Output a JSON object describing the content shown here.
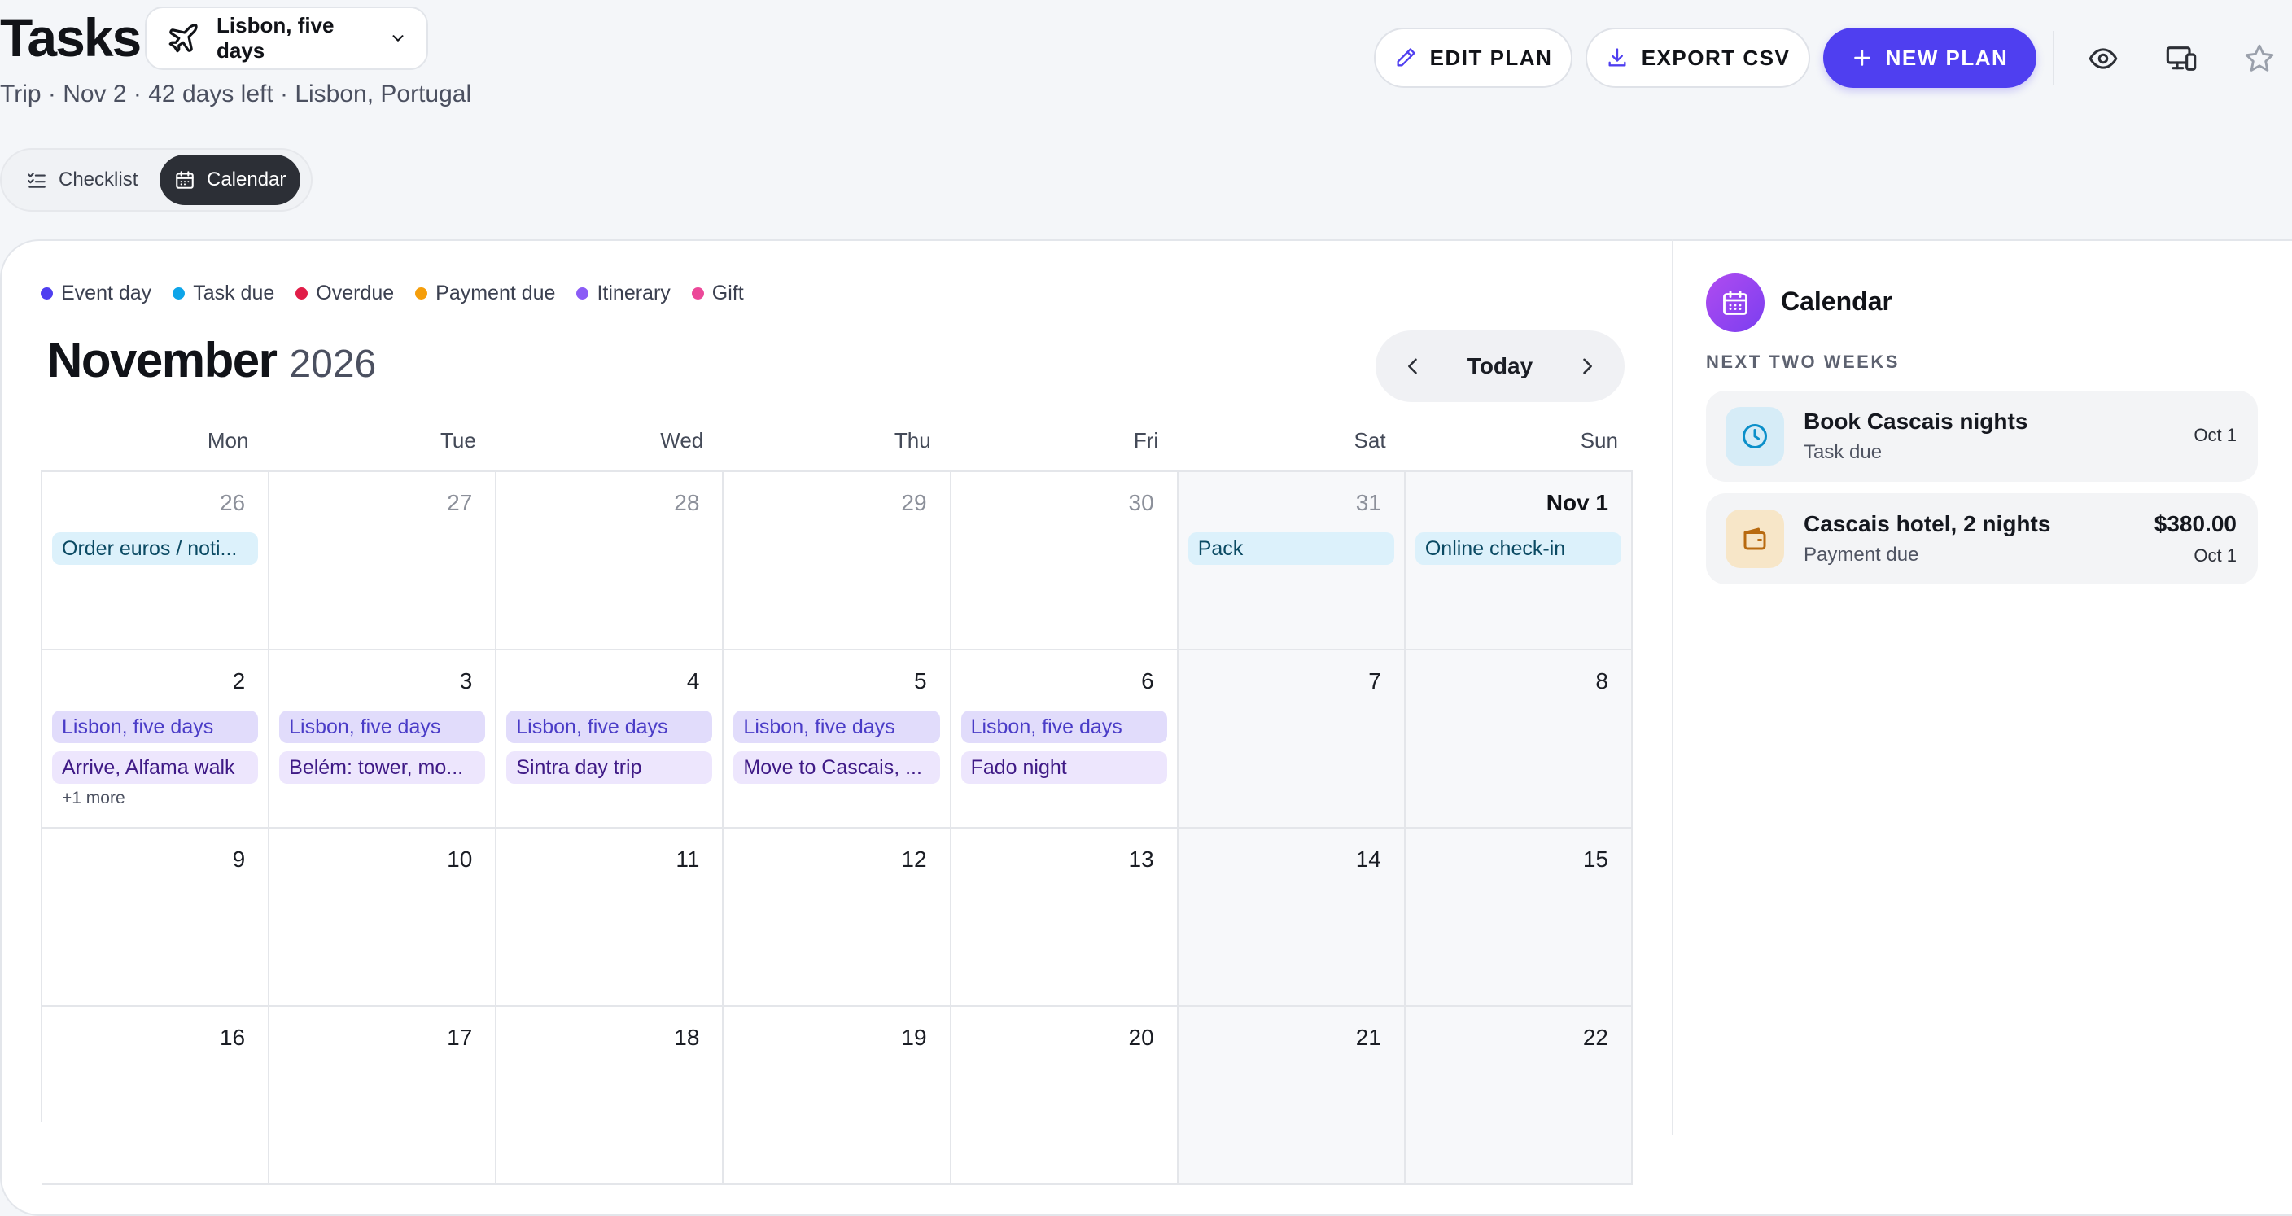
{
  "header": {
    "title": "Tasks",
    "plan_select_label": "Lisbon, five days",
    "subtitle": "Trip · Nov 2 · 42 days left · Lisbon, Portugal",
    "edit_label": "EDIT PLAN",
    "export_label": "EXPORT CSV",
    "new_label": "NEW PLAN"
  },
  "view_toggle": {
    "checklist": "Checklist",
    "calendar": "Calendar",
    "active": "calendar"
  },
  "legend": [
    {
      "label": "Event day",
      "color": "#4f3ff0"
    },
    {
      "label": "Task due",
      "color": "#0ea5e9"
    },
    {
      "label": "Overdue",
      "color": "#e11d48"
    },
    {
      "label": "Payment due",
      "color": "#f59e0b"
    },
    {
      "label": "Itinerary",
      "color": "#8b5cf6"
    },
    {
      "label": "Gift",
      "color": "#ec4899"
    }
  ],
  "calendar": {
    "month": "November",
    "year": "2026",
    "today_label": "Today",
    "weekdays": [
      "Mon",
      "Tue",
      "Wed",
      "Thu",
      "Fri",
      "Sat",
      "Sun"
    ]
  },
  "weeks": [
    [
      {
        "day": "26",
        "style": "dim",
        "events": [
          {
            "text": "Order euros / noti...",
            "kind": "task"
          }
        ]
      },
      {
        "day": "27",
        "style": "dim",
        "events": []
      },
      {
        "day": "28",
        "style": "dim",
        "events": []
      },
      {
        "day": "29",
        "style": "dim",
        "events": []
      },
      {
        "day": "30",
        "style": "dim",
        "events": []
      },
      {
        "day": "31",
        "style": "dim",
        "events": [
          {
            "text": "Pack",
            "kind": "task"
          }
        ]
      },
      {
        "day": "Nov 1",
        "style": "bold",
        "events": [
          {
            "text": "Online check-in",
            "kind": "task"
          }
        ]
      }
    ],
    [
      {
        "day": "2",
        "events": [
          {
            "text": "Lisbon, five days",
            "kind": "trip"
          },
          {
            "text": "Arrive, Alfama walk",
            "kind": "itin"
          }
        ],
        "more": "+1 more"
      },
      {
        "day": "3",
        "events": [
          {
            "text": "Lisbon, five days",
            "kind": "trip"
          },
          {
            "text": "Belém: tower, mo...",
            "kind": "itin"
          }
        ]
      },
      {
        "day": "4",
        "events": [
          {
            "text": "Lisbon, five days",
            "kind": "trip"
          },
          {
            "text": "Sintra day trip",
            "kind": "itin"
          }
        ]
      },
      {
        "day": "5",
        "events": [
          {
            "text": "Lisbon, five days",
            "kind": "trip"
          },
          {
            "text": "Move to Cascais, ...",
            "kind": "itin"
          }
        ]
      },
      {
        "day": "6",
        "events": [
          {
            "text": "Lisbon, five days",
            "kind": "trip"
          },
          {
            "text": "Fado night",
            "kind": "itin"
          }
        ]
      },
      {
        "day": "7",
        "events": []
      },
      {
        "day": "8",
        "events": []
      }
    ],
    [
      {
        "day": "9",
        "events": []
      },
      {
        "day": "10",
        "events": []
      },
      {
        "day": "11",
        "events": []
      },
      {
        "day": "12",
        "events": []
      },
      {
        "day": "13",
        "events": []
      },
      {
        "day": "14",
        "events": []
      },
      {
        "day": "15",
        "events": []
      }
    ],
    [
      {
        "day": "16",
        "events": []
      },
      {
        "day": "17",
        "events": []
      },
      {
        "day": "18",
        "events": []
      },
      {
        "day": "19",
        "events": []
      },
      {
        "day": "20",
        "events": []
      },
      {
        "day": "21",
        "events": []
      },
      {
        "day": "22",
        "events": []
      }
    ]
  ],
  "side_panel": {
    "title": "Calendar",
    "subtitle": "NEXT TWO WEEKS",
    "items": [
      {
        "title": "Book Cascais nights",
        "type": "Task due",
        "date": "Oct 1",
        "icon": "clock-icon"
      },
      {
        "title": "Cascais hotel, 2 nights",
        "type": "Payment due",
        "date": "Oct 1",
        "amount": "$380.00",
        "icon": "wallet-icon"
      }
    ]
  },
  "colors": {
    "accent": "#4f3ff0",
    "task_bg": "#dcf1fb",
    "trip_bg": "#e1dcfb",
    "itinerary_bg": "#ede6fd"
  }
}
